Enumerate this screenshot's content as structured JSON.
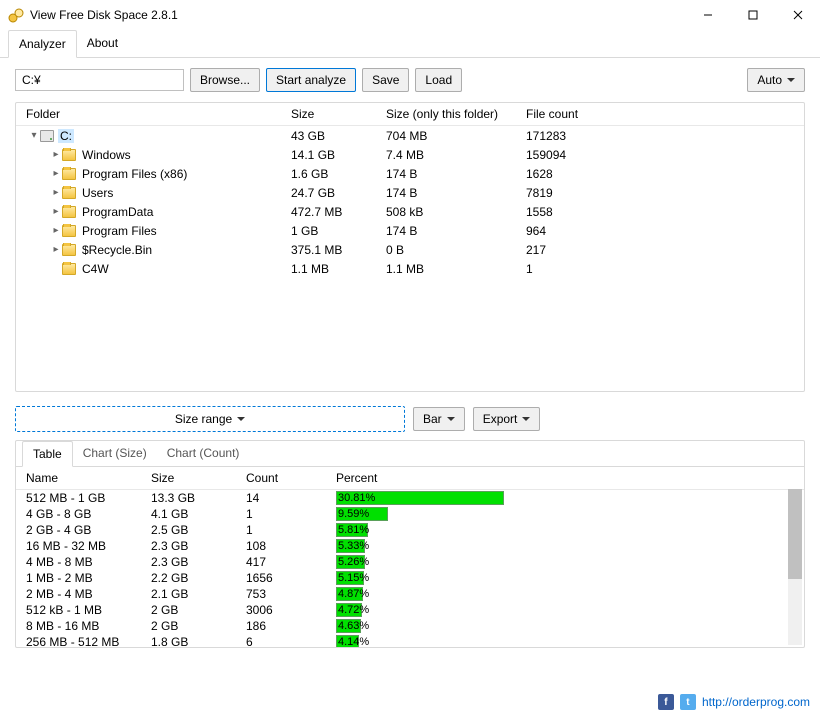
{
  "window": {
    "title": "View Free Disk Space 2.8.1"
  },
  "menu": {
    "analyzer": "Analyzer",
    "about": "About"
  },
  "toolbar": {
    "path": "C:¥",
    "browse": "Browse...",
    "start": "Start analyze",
    "save": "Save",
    "load": "Load",
    "auto": "Auto"
  },
  "tree": {
    "headers": {
      "folder": "Folder",
      "size": "Size",
      "sizeonly": "Size (only this folder)",
      "count": "File count"
    },
    "rows": [
      {
        "level": 0,
        "expander": "▾",
        "icon": "drive",
        "name": "C:",
        "size": "43 GB",
        "sizeonly": "704 MB",
        "count": "171283",
        "selected": true
      },
      {
        "level": 1,
        "expander": "▸",
        "icon": "folder",
        "name": "Windows",
        "size": "14.1 GB",
        "sizeonly": "7.4 MB",
        "count": "159094"
      },
      {
        "level": 1,
        "expander": "▸",
        "icon": "folder",
        "name": "Program Files (x86)",
        "size": "1.6 GB",
        "sizeonly": "174 B",
        "count": "1628"
      },
      {
        "level": 1,
        "expander": "▸",
        "icon": "folder",
        "name": "Users",
        "size": "24.7 GB",
        "sizeonly": "174 B",
        "count": "7819"
      },
      {
        "level": 1,
        "expander": "▸",
        "icon": "folder",
        "name": "ProgramData",
        "size": "472.7 MB",
        "sizeonly": "508 kB",
        "count": "1558"
      },
      {
        "level": 1,
        "expander": "▸",
        "icon": "folder",
        "name": "Program Files",
        "size": "1 GB",
        "sizeonly": "174 B",
        "count": "964"
      },
      {
        "level": 1,
        "expander": "▸",
        "icon": "folder",
        "name": "$Recycle.Bin",
        "size": "375.1 MB",
        "sizeonly": "0 B",
        "count": "217"
      },
      {
        "level": 1,
        "expander": "",
        "icon": "folder",
        "name": "C4W",
        "size": "1.1 MB",
        "sizeonly": "1.1 MB",
        "count": "1"
      }
    ]
  },
  "mid": {
    "range": "Size range",
    "bar": "Bar",
    "export": "Export"
  },
  "bottom": {
    "tabs": {
      "table": "Table",
      "chartsize": "Chart (Size)",
      "chartcount": "Chart (Count)"
    },
    "headers": {
      "name": "Name",
      "size": "Size",
      "count": "Count",
      "percent": "Percent"
    },
    "rows": [
      {
        "name": "512 MB - 1 GB",
        "size": "13.3 GB",
        "count": "14",
        "percent": 30.81,
        "pct_label": "30.81%"
      },
      {
        "name": "4 GB - 8 GB",
        "size": "4.1 GB",
        "count": "1",
        "percent": 9.59,
        "pct_label": "9.59%"
      },
      {
        "name": "2 GB - 4 GB",
        "size": "2.5 GB",
        "count": "1",
        "percent": 5.81,
        "pct_label": "5.81%"
      },
      {
        "name": "16 MB - 32 MB",
        "size": "2.3 GB",
        "count": "108",
        "percent": 5.33,
        "pct_label": "5.33%"
      },
      {
        "name": "4 MB - 8 MB",
        "size": "2.3 GB",
        "count": "417",
        "percent": 5.26,
        "pct_label": "5.26%"
      },
      {
        "name": "1 MB - 2 MB",
        "size": "2.2 GB",
        "count": "1656",
        "percent": 5.15,
        "pct_label": "5.15%"
      },
      {
        "name": "2 MB - 4 MB",
        "size": "2.1 GB",
        "count": "753",
        "percent": 4.87,
        "pct_label": "4.87%"
      },
      {
        "name": "512 kB - 1 MB",
        "size": "2 GB",
        "count": "3006",
        "percent": 4.72,
        "pct_label": "4.72%"
      },
      {
        "name": "8 MB - 16 MB",
        "size": "2 GB",
        "count": "186",
        "percent": 4.63,
        "pct_label": "4.63%"
      },
      {
        "name": "256 MB - 512 MB",
        "size": "1.8 GB",
        "count": "6",
        "percent": 4.14,
        "pct_label": "4.14%"
      }
    ]
  },
  "status": {
    "link": "http://orderprog.com"
  },
  "chart_data": {
    "type": "bar",
    "title": "Percent of total size by file-size range",
    "xlabel": "Size range",
    "ylabel": "Percent",
    "ylim": [
      0,
      35
    ],
    "categories": [
      "512 MB - 1 GB",
      "4 GB - 8 GB",
      "2 GB - 4 GB",
      "16 MB - 32 MB",
      "4 MB - 8 MB",
      "1 MB - 2 MB",
      "2 MB - 4 MB",
      "512 kB - 1 MB",
      "8 MB - 16 MB",
      "256 MB - 512 MB"
    ],
    "values": [
      30.81,
      9.59,
      5.81,
      5.33,
      5.26,
      5.15,
      4.87,
      4.72,
      4.63,
      4.14
    ]
  }
}
